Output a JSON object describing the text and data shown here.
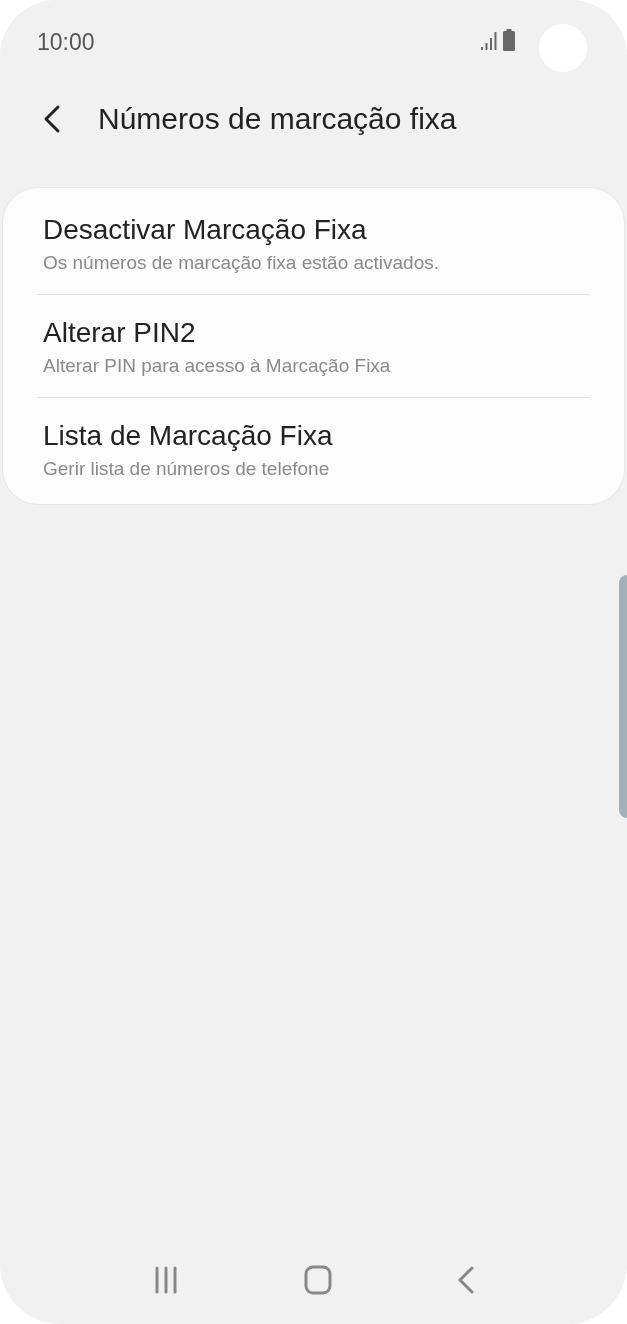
{
  "status_bar": {
    "time": "10:00"
  },
  "header": {
    "title": "Números de marcação fixa"
  },
  "items": [
    {
      "title": "Desactivar Marcação Fixa",
      "subtitle": "Os números de marcação fixa estão activados."
    },
    {
      "title": "Alterar PIN2",
      "subtitle": "Alterar PIN para acesso à Marcação Fixa"
    },
    {
      "title": "Lista de Marcação Fixa",
      "subtitle": "Gerir lista de números de telefone"
    }
  ]
}
